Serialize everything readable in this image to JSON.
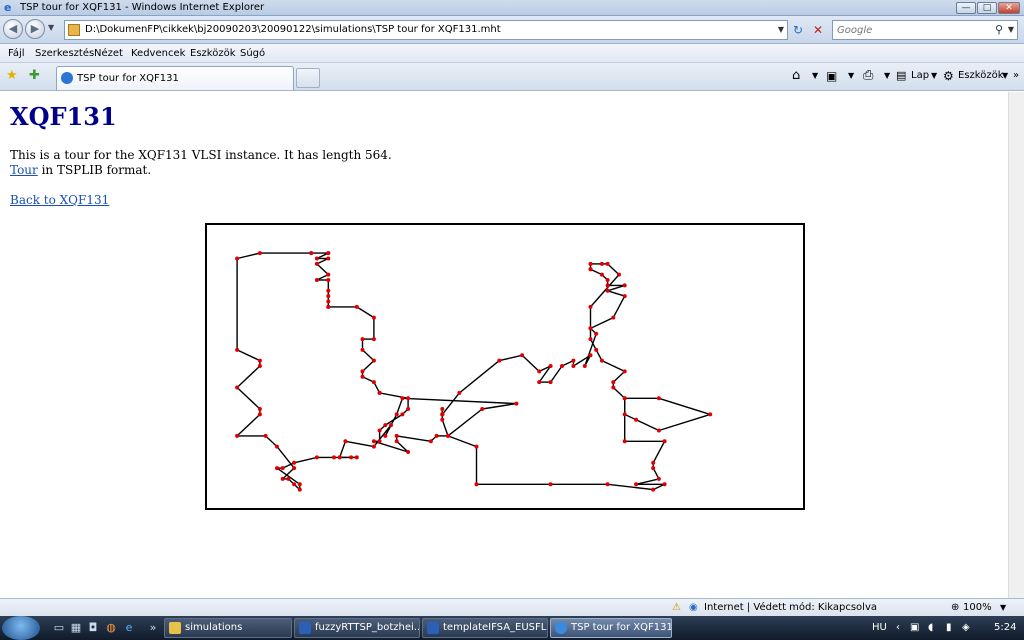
{
  "window": {
    "title": "TSP tour for XQF131 - Windows Internet Explorer",
    "controls": {
      "minimize": "—",
      "maximize": "□",
      "close": "✕"
    }
  },
  "navbar": {
    "back": "◀",
    "forward": "▶",
    "address": "D:\\DokumenFP\\cikkek\\bj20090203\\20090122\\simulations\\TSP tour for XQF131.mht",
    "refresh": "↻",
    "stop": "✕",
    "search_placeholder": "Google",
    "search_glyph": "⚲"
  },
  "menu": [
    "Fájl",
    "Szerkesztés",
    "Nézet",
    "Kedvencek",
    "Eszközök",
    "Súgó"
  ],
  "tabs": {
    "active_label": "TSP tour for XQF131",
    "fav_star": "★",
    "add_fav": "✚"
  },
  "commandbar": {
    "home": "⌂",
    "feeds": "▣",
    "print": "⎙",
    "page_label": "Lap",
    "tools_label": "Eszközök",
    "more": "»"
  },
  "page": {
    "heading": "XQF131",
    "intro": "This is a tour for the XQF131 VLSI instance. It has length 564.",
    "tour_link": "Tour",
    "tour_suffix": " in TSPLIB format.",
    "back_link": "Back to XQF131"
  },
  "chart_data": {
    "type": "line",
    "title": "",
    "xlabel": "",
    "ylabel": "",
    "xlim": [
      0,
      100
    ],
    "ylim": [
      0,
      48
    ],
    "grid": false,
    "legend": "none",
    "line_color": "#000000",
    "point_color": "#e00000",
    "series": [
      {
        "closed": true,
        "x": [
          3,
          7,
          16,
          16,
          19,
          19,
          17,
          19,
          17,
          19,
          17,
          19,
          19,
          19,
          19,
          19,
          19,
          24,
          27,
          27,
          25,
          25,
          27,
          25,
          25,
          27,
          28,
          28,
          33,
          33,
          32,
          29,
          28,
          28,
          27,
          33,
          31,
          31,
          37,
          38,
          40,
          39,
          39,
          39,
          39,
          39,
          42,
          49,
          53,
          56,
          58,
          56,
          58,
          60,
          62,
          62,
          65,
          64,
          66,
          65,
          69,
          71,
          68,
          71,
          68,
          68,
          67,
          65,
          65,
          65,
          67,
          68,
          70,
          65,
          65,
          65,
          66,
          67,
          71,
          69,
          69,
          71,
          71,
          73,
          77,
          86,
          77,
          71,
          71,
          78,
          76,
          76,
          77,
          73,
          78,
          76,
          68,
          58,
          45,
          45,
          40,
          46,
          52,
          32,
          31,
          29,
          30,
          27,
          22,
          21,
          23,
          24,
          20,
          17,
          13,
          11,
          10,
          14,
          14,
          13,
          12,
          11,
          13,
          10,
          8,
          3,
          7,
          7,
          3,
          7,
          7,
          3
        ],
        "y": [
          44,
          45,
          45,
          45,
          45,
          45,
          44,
          44,
          43,
          41,
          40,
          40,
          38,
          37,
          36,
          35,
          35,
          35,
          33,
          29,
          29,
          27,
          25,
          23,
          22,
          21,
          19,
          19,
          18,
          16,
          15,
          13,
          12,
          10,
          10,
          8,
          10,
          11,
          10,
          11,
          11,
          14,
          15,
          15,
          16,
          15,
          19,
          25,
          26,
          23,
          24,
          21,
          21,
          24,
          25,
          24,
          26,
          24,
          30,
          31,
          33,
          37,
          38,
          39,
          39,
          40,
          41,
          42,
          42,
          43,
          43,
          43,
          41,
          35,
          31,
          29,
          27,
          25,
          23,
          21,
          20,
          18,
          15,
          14,
          12,
          15,
          18,
          18,
          10,
          10,
          6,
          5,
          3,
          2,
          2,
          1,
          2,
          2,
          2,
          9,
          11,
          16,
          17,
          18,
          15,
          11,
          13,
          9,
          10,
          7,
          7,
          7,
          7,
          7,
          6,
          5,
          5,
          2,
          1,
          2,
          3,
          3,
          5,
          9,
          11,
          11,
          15,
          16,
          20,
          24,
          25,
          27
        ]
      }
    ]
  },
  "status": {
    "zone": "Internet | Védett mód: Kikapcsolva",
    "zoom": "100%",
    "zoom_glyph": "⊕"
  },
  "taskbar": {
    "items": [
      "simulations",
      "fuzzyRTTSP_botzhei...",
      "templateIFSA_EUSFL...",
      "TSP tour for XQF131..."
    ],
    "lang": "HU",
    "time": "5:24",
    "overflow": "»"
  }
}
